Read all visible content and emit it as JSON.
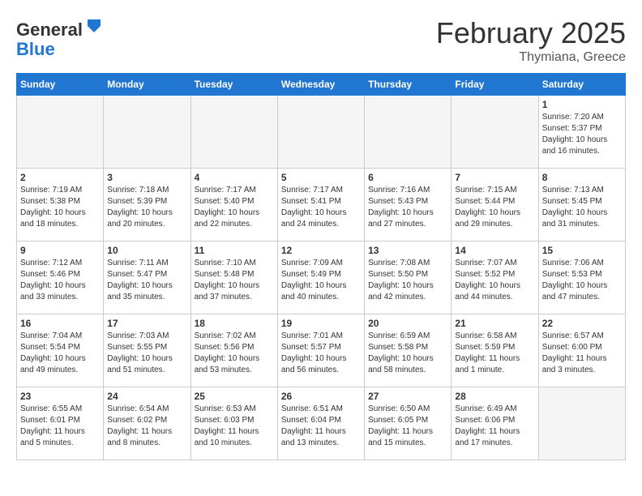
{
  "header": {
    "logo_general": "General",
    "logo_blue": "Blue",
    "month_title": "February 2025",
    "subtitle": "Thymiana, Greece"
  },
  "days_of_week": [
    "Sunday",
    "Monday",
    "Tuesday",
    "Wednesday",
    "Thursday",
    "Friday",
    "Saturday"
  ],
  "weeks": [
    [
      {
        "day": "",
        "info": ""
      },
      {
        "day": "",
        "info": ""
      },
      {
        "day": "",
        "info": ""
      },
      {
        "day": "",
        "info": ""
      },
      {
        "day": "",
        "info": ""
      },
      {
        "day": "",
        "info": ""
      },
      {
        "day": "1",
        "info": "Sunrise: 7:20 AM\nSunset: 5:37 PM\nDaylight: 10 hours\nand 16 minutes."
      }
    ],
    [
      {
        "day": "2",
        "info": "Sunrise: 7:19 AM\nSunset: 5:38 PM\nDaylight: 10 hours\nand 18 minutes."
      },
      {
        "day": "3",
        "info": "Sunrise: 7:18 AM\nSunset: 5:39 PM\nDaylight: 10 hours\nand 20 minutes."
      },
      {
        "day": "4",
        "info": "Sunrise: 7:17 AM\nSunset: 5:40 PM\nDaylight: 10 hours\nand 22 minutes."
      },
      {
        "day": "5",
        "info": "Sunrise: 7:17 AM\nSunset: 5:41 PM\nDaylight: 10 hours\nand 24 minutes."
      },
      {
        "day": "6",
        "info": "Sunrise: 7:16 AM\nSunset: 5:43 PM\nDaylight: 10 hours\nand 27 minutes."
      },
      {
        "day": "7",
        "info": "Sunrise: 7:15 AM\nSunset: 5:44 PM\nDaylight: 10 hours\nand 29 minutes."
      },
      {
        "day": "8",
        "info": "Sunrise: 7:13 AM\nSunset: 5:45 PM\nDaylight: 10 hours\nand 31 minutes."
      }
    ],
    [
      {
        "day": "9",
        "info": "Sunrise: 7:12 AM\nSunset: 5:46 PM\nDaylight: 10 hours\nand 33 minutes."
      },
      {
        "day": "10",
        "info": "Sunrise: 7:11 AM\nSunset: 5:47 PM\nDaylight: 10 hours\nand 35 minutes."
      },
      {
        "day": "11",
        "info": "Sunrise: 7:10 AM\nSunset: 5:48 PM\nDaylight: 10 hours\nand 37 minutes."
      },
      {
        "day": "12",
        "info": "Sunrise: 7:09 AM\nSunset: 5:49 PM\nDaylight: 10 hours\nand 40 minutes."
      },
      {
        "day": "13",
        "info": "Sunrise: 7:08 AM\nSunset: 5:50 PM\nDaylight: 10 hours\nand 42 minutes."
      },
      {
        "day": "14",
        "info": "Sunrise: 7:07 AM\nSunset: 5:52 PM\nDaylight: 10 hours\nand 44 minutes."
      },
      {
        "day": "15",
        "info": "Sunrise: 7:06 AM\nSunset: 5:53 PM\nDaylight: 10 hours\nand 47 minutes."
      }
    ],
    [
      {
        "day": "16",
        "info": "Sunrise: 7:04 AM\nSunset: 5:54 PM\nDaylight: 10 hours\nand 49 minutes."
      },
      {
        "day": "17",
        "info": "Sunrise: 7:03 AM\nSunset: 5:55 PM\nDaylight: 10 hours\nand 51 minutes."
      },
      {
        "day": "18",
        "info": "Sunrise: 7:02 AM\nSunset: 5:56 PM\nDaylight: 10 hours\nand 53 minutes."
      },
      {
        "day": "19",
        "info": "Sunrise: 7:01 AM\nSunset: 5:57 PM\nDaylight: 10 hours\nand 56 minutes."
      },
      {
        "day": "20",
        "info": "Sunrise: 6:59 AM\nSunset: 5:58 PM\nDaylight: 10 hours\nand 58 minutes."
      },
      {
        "day": "21",
        "info": "Sunrise: 6:58 AM\nSunset: 5:59 PM\nDaylight: 11 hours\nand 1 minute."
      },
      {
        "day": "22",
        "info": "Sunrise: 6:57 AM\nSunset: 6:00 PM\nDaylight: 11 hours\nand 3 minutes."
      }
    ],
    [
      {
        "day": "23",
        "info": "Sunrise: 6:55 AM\nSunset: 6:01 PM\nDaylight: 11 hours\nand 5 minutes."
      },
      {
        "day": "24",
        "info": "Sunrise: 6:54 AM\nSunset: 6:02 PM\nDaylight: 11 hours\nand 8 minutes."
      },
      {
        "day": "25",
        "info": "Sunrise: 6:53 AM\nSunset: 6:03 PM\nDaylight: 11 hours\nand 10 minutes."
      },
      {
        "day": "26",
        "info": "Sunrise: 6:51 AM\nSunset: 6:04 PM\nDaylight: 11 hours\nand 13 minutes."
      },
      {
        "day": "27",
        "info": "Sunrise: 6:50 AM\nSunset: 6:05 PM\nDaylight: 11 hours\nand 15 minutes."
      },
      {
        "day": "28",
        "info": "Sunrise: 6:49 AM\nSunset: 6:06 PM\nDaylight: 11 hours\nand 17 minutes."
      },
      {
        "day": "",
        "info": ""
      }
    ]
  ]
}
